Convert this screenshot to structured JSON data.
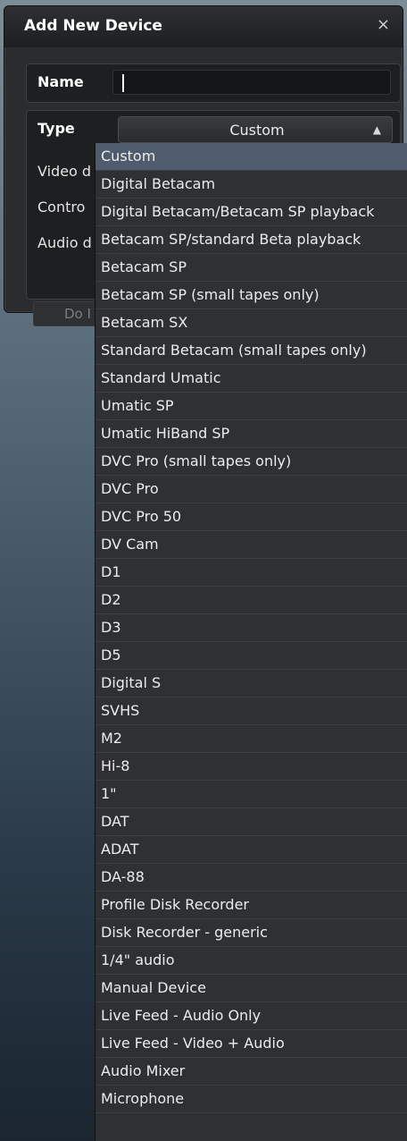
{
  "dialog": {
    "title": "Add New Device",
    "close_symbol": "×",
    "name_label": "Name",
    "name_value": "",
    "type_label": "Type",
    "type_value": "Custom",
    "field_labels": [
      "Video d",
      "Contro",
      "Audio d"
    ],
    "do_button_label": "Do I"
  },
  "dropdown": {
    "selected_index": 0,
    "items": [
      "Custom",
      "Digital Betacam",
      "Digital Betacam/Betacam SP playback",
      "Betacam SP/standard Beta playback",
      "Betacam SP",
      "Betacam SP (small tapes only)",
      "Betacam SX",
      "Standard Betacam (small tapes only)",
      "Standard Umatic",
      "Umatic SP",
      "Umatic HiBand SP",
      "DVC Pro (small tapes only)",
      "DVC Pro",
      "DVC Pro 50",
      "DV Cam",
      "D1",
      "D2",
      "D3",
      "D5",
      "Digital S",
      "SVHS",
      "M2",
      "Hi-8",
      "1\"",
      "DAT",
      "ADAT",
      "DA-88",
      "Profile Disk Recorder",
      "Disk Recorder - generic",
      "1/4\" audio",
      "Manual Device",
      "Live Feed - Audio Only",
      "Live Feed - Video + Audio",
      "Audio Mixer",
      "Microphone"
    ]
  },
  "colors": {
    "selected_item": "#4e5c6e",
    "dialog_bg": "#2b2c2e"
  }
}
